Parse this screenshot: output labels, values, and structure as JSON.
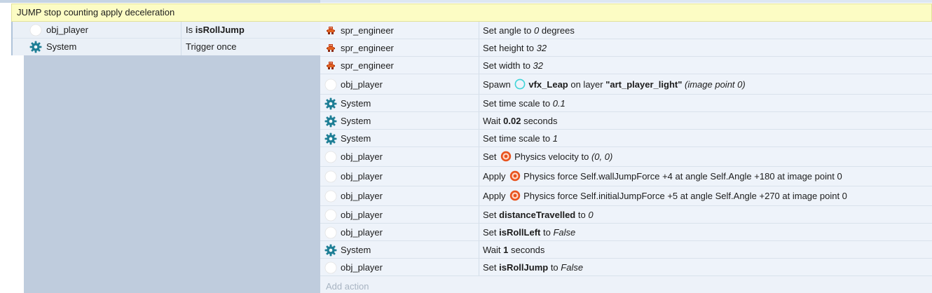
{
  "group": {
    "title": "JUMP stop counting apply deceleration"
  },
  "conditions": [
    {
      "object": "obj_player",
      "icon": "circle-object-icon",
      "parts": [
        {
          "t": "Is "
        },
        {
          "t": "isRollJump",
          "b": true
        }
      ]
    },
    {
      "object": "System",
      "icon": "gear-icon",
      "parts": [
        {
          "t": "Trigger once"
        }
      ]
    }
  ],
  "actions": [
    {
      "object": "spr_engineer",
      "icon": "sprite-icon",
      "parts": [
        {
          "t": "Set angle to "
        },
        {
          "t": "0",
          "i": true
        },
        {
          "t": " degrees"
        }
      ]
    },
    {
      "object": "spr_engineer",
      "icon": "sprite-icon",
      "parts": [
        {
          "t": "Set height to "
        },
        {
          "t": "32",
          "i": true
        }
      ]
    },
    {
      "object": "spr_engineer",
      "icon": "sprite-icon",
      "parts": [
        {
          "t": "Set width to "
        },
        {
          "t": "32",
          "i": true
        }
      ]
    },
    {
      "object": "obj_player",
      "icon": "circle-object-icon",
      "parts": [
        {
          "t": "Spawn "
        },
        {
          "ic": "cyan-circle-icon"
        },
        {
          "t": "vfx_Leap",
          "b": true
        },
        {
          "t": " on layer "
        },
        {
          "t": "\"art_player_light\"",
          "b": true
        },
        {
          "t": " (image point 0)",
          "i": true
        }
      ]
    },
    {
      "object": "System",
      "icon": "gear-icon",
      "parts": [
        {
          "t": "Set time scale to "
        },
        {
          "t": "0.1",
          "i": true
        }
      ]
    },
    {
      "object": "System",
      "icon": "gear-icon",
      "parts": [
        {
          "t": "Wait "
        },
        {
          "t": "0.02",
          "b": true
        },
        {
          "t": " seconds"
        }
      ]
    },
    {
      "object": "System",
      "icon": "gear-icon",
      "parts": [
        {
          "t": "Set time scale to "
        },
        {
          "t": "1",
          "i": true
        }
      ]
    },
    {
      "object": "obj_player",
      "icon": "circle-object-icon",
      "parts": [
        {
          "t": "Set "
        },
        {
          "ic": "physics-icon"
        },
        {
          "t": "Physics velocity to "
        },
        {
          "t": "(0, 0)",
          "i": true
        }
      ]
    },
    {
      "object": "obj_player",
      "icon": "circle-object-icon",
      "parts": [
        {
          "t": "Apply "
        },
        {
          "ic": "physics-icon"
        },
        {
          "t": "Physics force Self.wallJumpForce +4 at angle Self.Angle +180 at image point 0"
        }
      ]
    },
    {
      "object": "obj_player",
      "icon": "circle-object-icon",
      "parts": [
        {
          "t": "Apply "
        },
        {
          "ic": "physics-icon"
        },
        {
          "t": "Physics force Self.initialJumpForce +5 at angle Self.Angle +270 at image point 0"
        }
      ]
    },
    {
      "object": "obj_player",
      "icon": "circle-object-icon",
      "parts": [
        {
          "t": "Set "
        },
        {
          "t": "distanceTravelled",
          "b": true
        },
        {
          "t": " to "
        },
        {
          "t": "0",
          "i": true
        }
      ]
    },
    {
      "object": "obj_player",
      "icon": "circle-object-icon",
      "parts": [
        {
          "t": "Set "
        },
        {
          "t": "isRollLeft",
          "b": true
        },
        {
          "t": " to "
        },
        {
          "t": "False",
          "i": true
        }
      ]
    },
    {
      "object": "System",
      "icon": "gear-icon",
      "parts": [
        {
          "t": "Wait "
        },
        {
          "t": "1",
          "b": true
        },
        {
          "t": " seconds"
        }
      ]
    },
    {
      "object": "obj_player",
      "icon": "circle-object-icon",
      "parts": [
        {
          "t": "Set "
        },
        {
          "t": "isRollJump",
          "b": true
        },
        {
          "t": " to "
        },
        {
          "t": "False",
          "i": true
        }
      ]
    }
  ],
  "add_action_label": "Add action",
  "colors": {
    "group_header_bg": "#fcfcc4",
    "condition_bg": "#eaf0f7",
    "action_bg": "#eef3fa",
    "empty_area": "#bfccdd",
    "gear": "#1f7f96",
    "physics": "#e8531e",
    "spawn_circle": "#3fd4d8"
  }
}
